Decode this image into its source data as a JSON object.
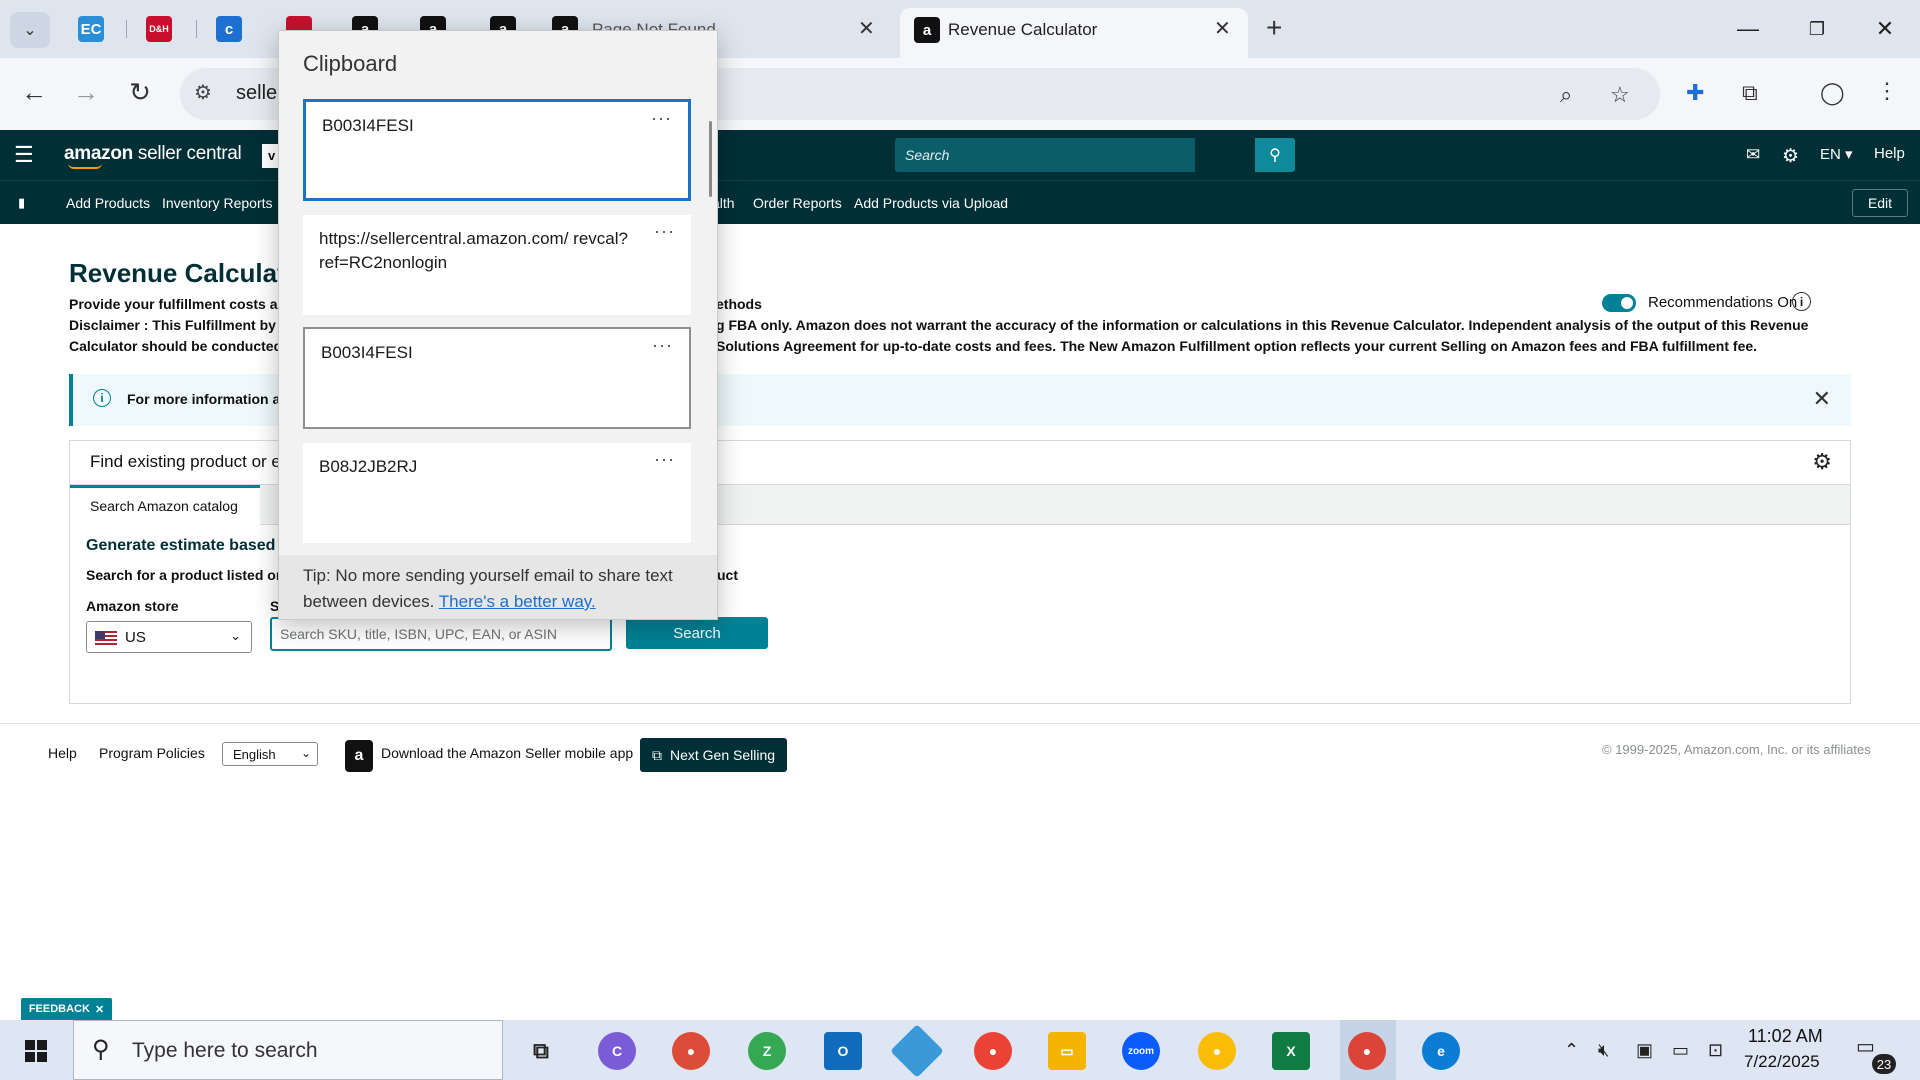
{
  "browser": {
    "tabs": [
      {
        "label": "Page Not Found"
      },
      {
        "label": "Revenue Calculator"
      }
    ],
    "url": "seller",
    "new_tab": "+"
  },
  "header": {
    "logo_amazon": "amazon",
    "logo_suffix": " seller central",
    "store_char": "v",
    "search_placeholder": "Search",
    "lang": "EN",
    "help": "Help"
  },
  "nav": {
    "items": [
      "Add Products",
      "Inventory Reports",
      "alth",
      "Order Reports",
      "Add Products via Upload"
    ],
    "edit": "Edit"
  },
  "page": {
    "title": "Revenue Calculator",
    "desc_line1": "Provide your fulfillment costs ar",
    "desc_line1_right": "ethods",
    "disclaimer_left": "Disclaimer : This Fulfillment by",
    "disclaimer_right": "g FBA only. Amazon does not warrant the accuracy of the information or calculations in this Revenue Calculator. Independent analysis of the output of this Revenue",
    "disclaimer2_left": "Calculator should be conducted",
    "disclaimer2_right": "Solutions Agreement for up-to-date costs and fees. The New Amazon Fulfillment option reflects your current Selling on Amazon fees and FBA fulfillment fee.",
    "recommendations": "Recommendations On",
    "info_banner": "For more information a",
    "card_header": "Find existing product or en",
    "tab_catalog": "Search Amazon catalog",
    "generate": "Generate estimate based c",
    "search_hint": "Search for a product listed on",
    "search_hint_right": "uct",
    "store_label": "Amazon store",
    "store_value": "US",
    "sku_label": "S",
    "sku_placeholder": "Search SKU, title, ISBN, UPC, EAN, or ASIN",
    "search_button": "Search"
  },
  "footer": {
    "help": "Help",
    "policies": "Program Policies",
    "language": "English",
    "app_text": "Download the Amazon Seller mobile app",
    "next_gen": "Next Gen Selling",
    "copyright": "© 1999-2025, Amazon.com, Inc. or its affiliates",
    "feedback": "FEEDBACK"
  },
  "clipboard": {
    "title": "Clipboard",
    "items": [
      {
        "text": "B003I4FESI"
      },
      {
        "text": "https://sellercentral.amazon.com/ revcal?ref=RC2nonlogin"
      },
      {
        "text": "B003I4FESI"
      },
      {
        "text": "B08J2JB2RJ"
      }
    ],
    "more": "···",
    "tip_text": "Tip: No more sending yourself email to share text between devices.",
    "tip_link": "There's a better way."
  },
  "taskbar": {
    "search_placeholder": "Type here to search",
    "time": "11:02 AM",
    "date": "7/22/2025",
    "notifications": "23"
  }
}
